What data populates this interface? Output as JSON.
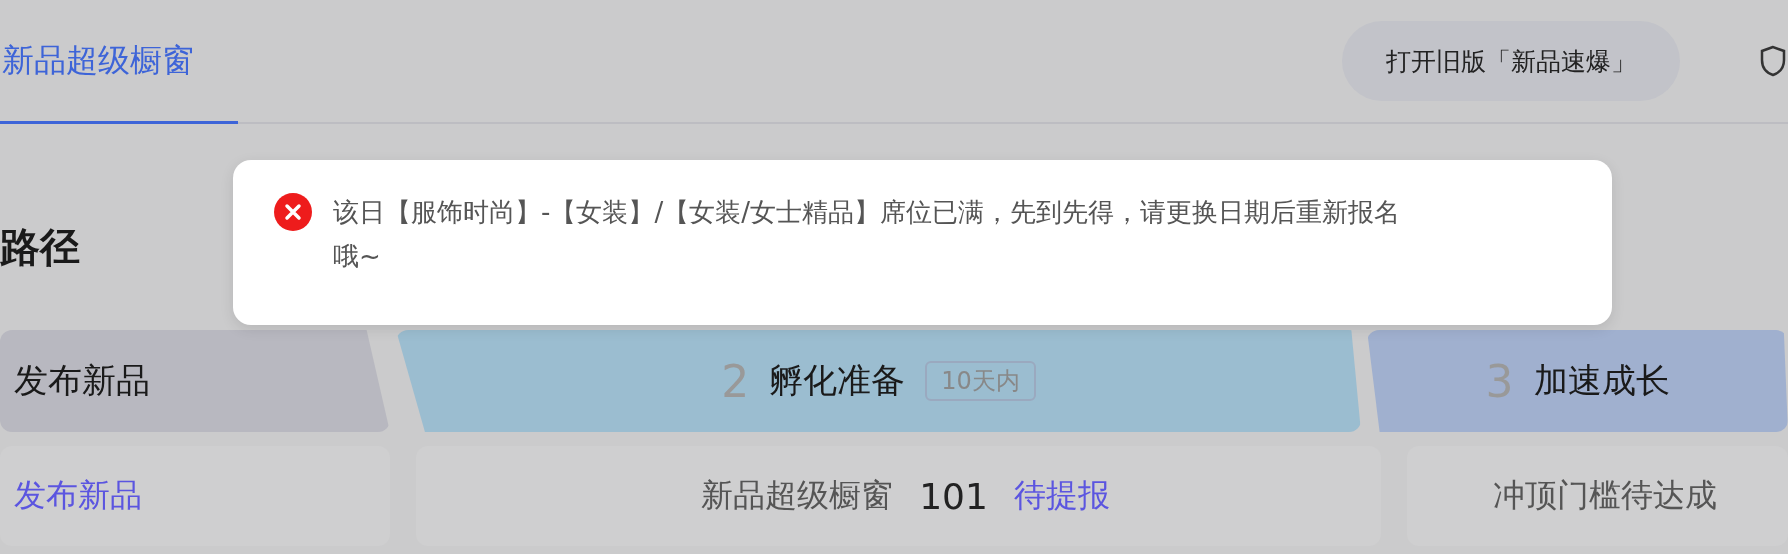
{
  "tabs": [
    {
      "label": "新品超级橱窗",
      "selected": true
    }
  ],
  "old_version_button": "打开旧版「新品速爆」",
  "section_title": "路径",
  "stages": [
    {
      "title": "发布新品",
      "color": "#b8b8c0"
    },
    {
      "number": "2",
      "title": "孵化准备",
      "tag": "10天内",
      "color": "#9bbdd0"
    },
    {
      "number": "3",
      "title": "加速成长",
      "color": "#a0b0cf"
    }
  ],
  "cards": [
    {
      "label": "发布新品",
      "kind": "link"
    },
    {
      "label": "新品超级橱窗",
      "count": "101",
      "action": "待提报",
      "kind": "stat"
    },
    {
      "label": "冲顶门槛待达成",
      "kind": "stat"
    }
  ],
  "toast": {
    "kind": "error",
    "message": "该日【服饰时尚】-【女装】/【女装/女士精品】席位已满，先到先得，请更换日期后重新报名哦~"
  }
}
